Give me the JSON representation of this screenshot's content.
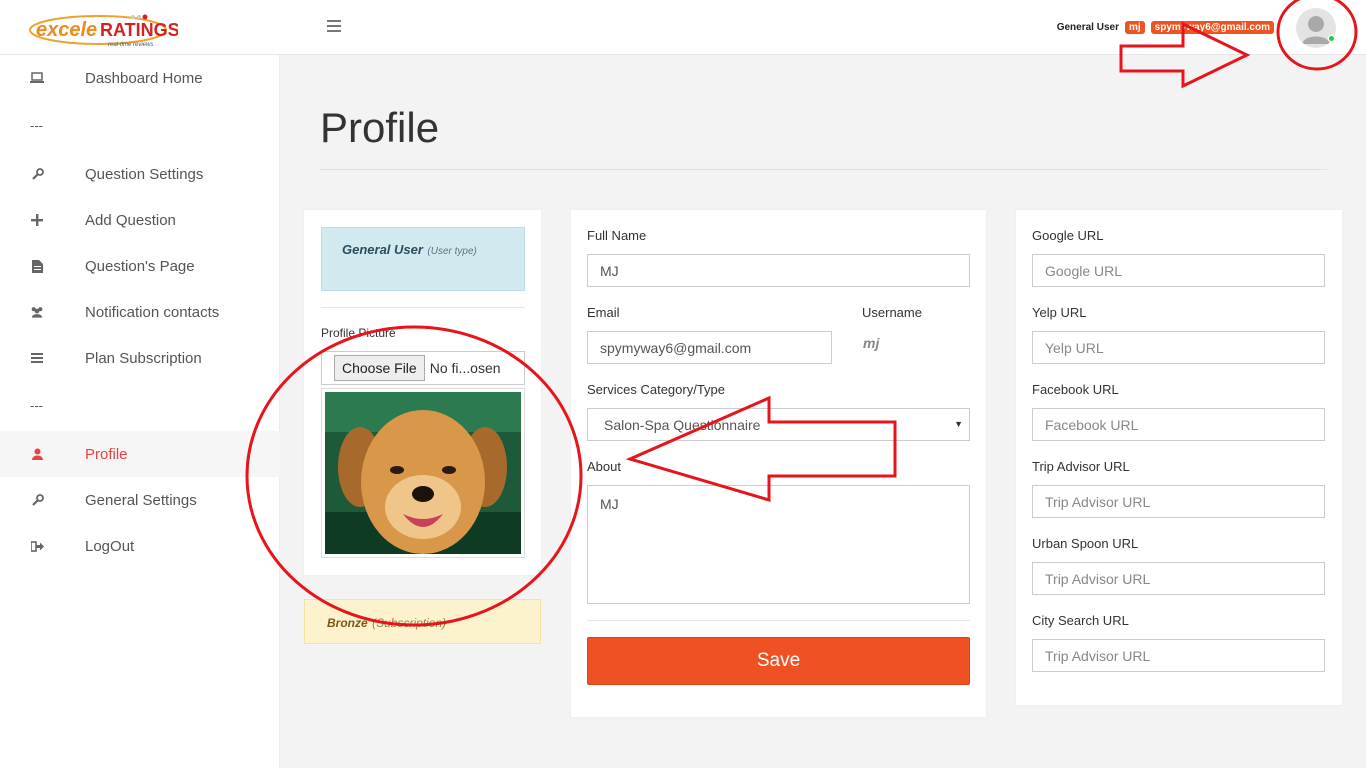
{
  "brand": {
    "logo_main": "exceleRATINGS",
    "logo_tagline": "real-time reviews"
  },
  "header": {
    "user_role": "General User",
    "user_tag": "mj",
    "email_tag": "spymyway6@gmail.com"
  },
  "sidebar": {
    "items": [
      {
        "label": "Dashboard Home",
        "icon": "laptop-icon"
      },
      {
        "label": "---"
      },
      {
        "label": "Question Settings",
        "icon": "wrench-icon"
      },
      {
        "label": "Add Question",
        "icon": "plus-icon"
      },
      {
        "label": "Question's Page",
        "icon": "file-icon"
      },
      {
        "label": "Notification contacts",
        "icon": "users-icon"
      },
      {
        "label": "Plan Subscription",
        "icon": "bars-icon"
      },
      {
        "label": "---"
      },
      {
        "label": "Profile",
        "icon": "user-icon",
        "active": true
      },
      {
        "label": "General Settings",
        "icon": "wrench-icon"
      },
      {
        "label": "LogOut",
        "icon": "sign-out-icon"
      }
    ]
  },
  "page": {
    "title": "Profile"
  },
  "left_card": {
    "user_type": "General User",
    "user_type_note": "(User type)",
    "profile_picture_label": "Profile Picture",
    "choose_file_label": "Choose File",
    "file_status": "No fi...osen",
    "subscription": "Bronze",
    "subscription_note": "(Subscription)"
  },
  "form": {
    "full_name_label": "Full Name",
    "full_name_value": "MJ",
    "email_label": "Email",
    "email_value": "spymyway6@gmail.com",
    "username_label": "Username",
    "username_value": "mj",
    "category_label": "Services Category/Type",
    "category_value": "Salon-Spa Questionnaire",
    "about_label": "About",
    "about_value": "MJ",
    "save_label": "Save"
  },
  "urls": [
    {
      "label": "Google URL",
      "placeholder": "Google URL"
    },
    {
      "label": "Yelp URL",
      "placeholder": "Yelp URL"
    },
    {
      "label": "Facebook URL",
      "placeholder": "Facebook URL"
    },
    {
      "label": "Trip Advisor URL",
      "placeholder": "Trip Advisor URL"
    },
    {
      "label": "Urban Spoon URL",
      "placeholder": "Trip Advisor URL"
    },
    {
      "label": "City Search URL",
      "placeholder": "Trip Advisor URL"
    }
  ],
  "colors": {
    "accent": "#ef5123",
    "active_nav": "#e84242",
    "annotation": "#e8141b"
  }
}
